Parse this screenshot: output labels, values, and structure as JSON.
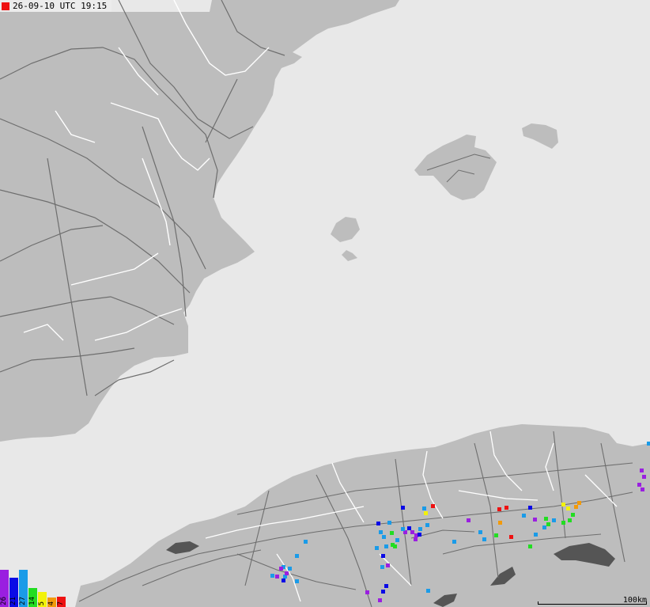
{
  "header": {
    "timestamp": "26-09-10 UTC 19:15",
    "marker_color": "#ee1111"
  },
  "colors": {
    "sea": "#e8e8e8",
    "land": "#bdbdbd",
    "lakes": "#555555",
    "roads": "#6e6e6e",
    "borders": "#ffffff"
  },
  "legend": [
    {
      "label": "26",
      "color": "#9a1fe0",
      "level": 0.98
    },
    {
      "label": "21",
      "color": "#0a0ae6",
      "level": 0.78
    },
    {
      "label": "27",
      "color": "#1a9be8",
      "level": 0.98
    },
    {
      "label": "14",
      "color": "#22dd22",
      "level": 0.5
    },
    {
      "label": "5",
      "color": "#f2f20a",
      "level": 0.4
    },
    {
      "label": "4",
      "color": "#f29a0a",
      "level": 0.25
    },
    {
      "label": "7",
      "color": "#ee1111",
      "level": 0.28
    }
  ],
  "scale": {
    "label": "100km"
  },
  "strikes": [
    [
      509,
      641,
      "#0a0ae6"
    ],
    [
      517,
      667,
      "#0a0ae6"
    ],
    [
      521,
      672,
      "#9a1fe0"
    ],
    [
      526,
      676,
      "#9a1fe0"
    ],
    [
      525,
      681,
      "#9a1fe0"
    ],
    [
      530,
      675,
      "#0a0ae6"
    ],
    [
      512,
      672,
      "#9a1fe0"
    ],
    [
      496,
      688,
      "#22dd22"
    ],
    [
      499,
      690,
      "#22dd22"
    ],
    [
      481,
      672,
      "#1a9be8"
    ],
    [
      478,
      661,
      "#0a0ae6"
    ],
    [
      492,
      660,
      "#1a9be8"
    ],
    [
      485,
      678,
      "#1a9be8"
    ],
    [
      488,
      690,
      "#1a9be8"
    ],
    [
      476,
      692,
      "#1a9be8"
    ],
    [
      502,
      682,
      "#1a9be8"
    ],
    [
      509,
      668,
      "#1a9be8"
    ],
    [
      495,
      673,
      "#22dd22"
    ],
    [
      538,
      648,
      "#f2f20a"
    ],
    [
      547,
      639,
      "#ee1111"
    ],
    [
      536,
      642,
      "#1a9be8"
    ],
    [
      540,
      663,
      "#1a9be8"
    ],
    [
      531,
      668,
      "#1a9be8"
    ],
    [
      484,
      702,
      "#0a0ae6"
    ],
    [
      490,
      714,
      "#9a1fe0"
    ],
    [
      483,
      716,
      "#1a9be8"
    ],
    [
      574,
      684,
      "#1a9be8"
    ],
    [
      386,
      684,
      "#1a9be8"
    ],
    [
      375,
      702,
      "#1a9be8"
    ],
    [
      358,
      716,
      "#1a9be8"
    ],
    [
      360,
      728,
      "#1a9be8"
    ],
    [
      355,
      718,
      "#9a1fe0"
    ],
    [
      362,
      724,
      "#9a1fe0"
    ],
    [
      350,
      728,
      "#9a1fe0"
    ],
    [
      358,
      733,
      "#0a0ae6"
    ],
    [
      366,
      718,
      "#1a9be8"
    ],
    [
      375,
      734,
      "#1a9be8"
    ],
    [
      344,
      727,
      "#1a9be8"
    ],
    [
      488,
      740,
      "#0a0ae6"
    ],
    [
      484,
      747,
      "#0a0ae6"
    ],
    [
      480,
      758,
      "#9a1fe0"
    ],
    [
      464,
      748,
      "#9a1fe0"
    ],
    [
      541,
      746,
      "#1a9be8"
    ],
    [
      631,
      643,
      "#ee1111"
    ],
    [
      640,
      641,
      "#ee1111"
    ],
    [
      632,
      660,
      "#f29a0a"
    ],
    [
      607,
      672,
      "#1a9be8"
    ],
    [
      612,
      681,
      "#1a9be8"
    ],
    [
      627,
      676,
      "#22dd22"
    ],
    [
      646,
      678,
      "#ee1111"
    ],
    [
      670,
      641,
      "#0a0ae6"
    ],
    [
      662,
      651,
      "#1a9be8"
    ],
    [
      676,
      656,
      "#9a1fe0"
    ],
    [
      690,
      655,
      "#22dd22"
    ],
    [
      693,
      662,
      "#22dd22"
    ],
    [
      700,
      657,
      "#1a9be8"
    ],
    [
      712,
      637,
      "#f2f20a"
    ],
    [
      718,
      642,
      "#f2f20a"
    ],
    [
      728,
      640,
      "#f29a0a"
    ],
    [
      732,
      635,
      "#f29a0a"
    ],
    [
      724,
      650,
      "#22dd22"
    ],
    [
      720,
      657,
      "#22dd22"
    ],
    [
      712,
      660,
      "#22dd22"
    ],
    [
      688,
      666,
      "#1a9be8"
    ],
    [
      677,
      675,
      "#1a9be8"
    ],
    [
      670,
      690,
      "#22dd22"
    ],
    [
      592,
      657,
      "#9a1fe0"
    ],
    [
      811,
      594,
      "#9a1fe0"
    ],
    [
      814,
      602,
      "#9a1fe0"
    ],
    [
      808,
      612,
      "#9a1fe0"
    ],
    [
      812,
      618,
      "#9a1fe0"
    ],
    [
      820,
      560,
      "#1a9be8"
    ]
  ]
}
